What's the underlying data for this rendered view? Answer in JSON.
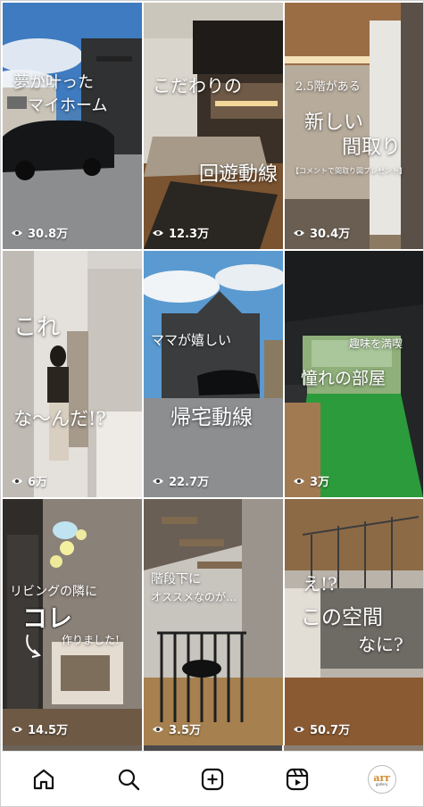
{
  "posts": [
    {
      "caption_lines": [
        "夢が叶った",
        "マイホーム"
      ],
      "views": "30.8万"
    },
    {
      "caption_lines": [
        "こだわりの",
        "回遊動線"
      ],
      "views": "12.3万"
    },
    {
      "caption_lines": [
        "2.5階がある",
        "新しい",
        "間取り",
        "【コメントで間取り図プレゼント】"
      ],
      "views": "30.4万"
    },
    {
      "caption_lines": [
        "これ",
        "な〜んだ!?"
      ],
      "views": "6万"
    },
    {
      "caption_lines": [
        "ママが嬉しい",
        "帰宅動線"
      ],
      "views": "22.7万"
    },
    {
      "caption_lines": [
        "趣味を満喫",
        "憧れの部屋"
      ],
      "views": "3万"
    },
    {
      "caption_lines": [
        "リビングの隣に",
        "コレ",
        "作りました!"
      ],
      "views": "14.5万"
    },
    {
      "caption_lines": [
        "階段下に",
        "オススメなのが…"
      ],
      "views": "3.5万"
    },
    {
      "caption_lines": [
        "え!?",
        "この空間",
        "なに?"
      ],
      "views": "50.7万"
    }
  ],
  "nav": [
    {
      "icon": "home-icon"
    },
    {
      "icon": "search-icon"
    },
    {
      "icon": "create-post-icon"
    },
    {
      "icon": "reels-icon"
    },
    {
      "icon": "profile-avatar",
      "text": "arr",
      "subtext": "gallery"
    }
  ],
  "colors": {
    "text": "#ffffff",
    "nav_bg": "#ffffff",
    "icon": "#111111",
    "avatar_accent": "#d38a2e"
  }
}
